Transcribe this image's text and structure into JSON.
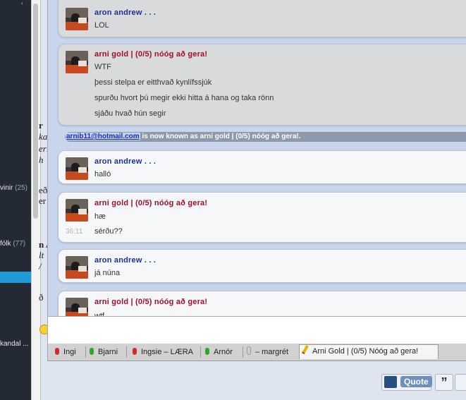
{
  "sidebar": {
    "items": [
      {
        "label": "vinir",
        "count": "(25)"
      },
      {
        "label": "fólk",
        "count": "(77)"
      },
      {
        "label": "kandal ..."
      }
    ]
  },
  "background_page": {
    "fragments": [
      "r",
      "ka",
      "eri",
      "h",
      "eð",
      "er",
      "n A",
      "lt",
      "/",
      "ð"
    ]
  },
  "chat": {
    "messages": [
      {
        "sender": "aron andrew . . .",
        "lines": [
          "LOL"
        ]
      },
      {
        "sender": "arni gold | (0/5) nóóg að gera!",
        "lines": [
          "WTF",
          "þessi stelpa er eitthvað kynlífssjúk",
          "spurðu hvort þú megir ekki hitta á hana og taka rönn",
          "sjáðu hvað hún segir"
        ]
      },
      {
        "sender": "aron andrew . . .",
        "lines": [
          "halló"
        ]
      },
      {
        "sender": "arni gold | (0/5) nóóg að gera!",
        "lines": [
          "hæ",
          "sérðu??"
        ],
        "timestamp": "36:11"
      },
      {
        "sender": "aron andrew . . .",
        "lines": [
          "já núna"
        ]
      },
      {
        "sender": "arni gold | (0/5) nóóg að gera!",
        "lines": [
          "wtf"
        ]
      }
    ],
    "status": {
      "email": "arnib11@hotmail.com",
      "text": " is now known as arni gold | (0/5) nóóg að gera!."
    },
    "input_value": ""
  },
  "tabs": [
    {
      "label": "Ingi",
      "status_color": "#d42a2a"
    },
    {
      "label": "Bjarni",
      "status_color": "#2ea62e"
    },
    {
      "label": "Ingsie – LÆRA",
      "status_color": "#d42a2a"
    },
    {
      "label": "Arnór",
      "status_color": "#2ea62e"
    },
    {
      "label": "– margrét",
      "status_color": "#cfcfcf"
    },
    {
      "label": "Arni Gold | (0/5) Nóóg að gera!",
      "active": true
    }
  ],
  "buttons": {
    "quote": "Quote",
    "multi_quote_icon": "multi-quote-icon"
  }
}
